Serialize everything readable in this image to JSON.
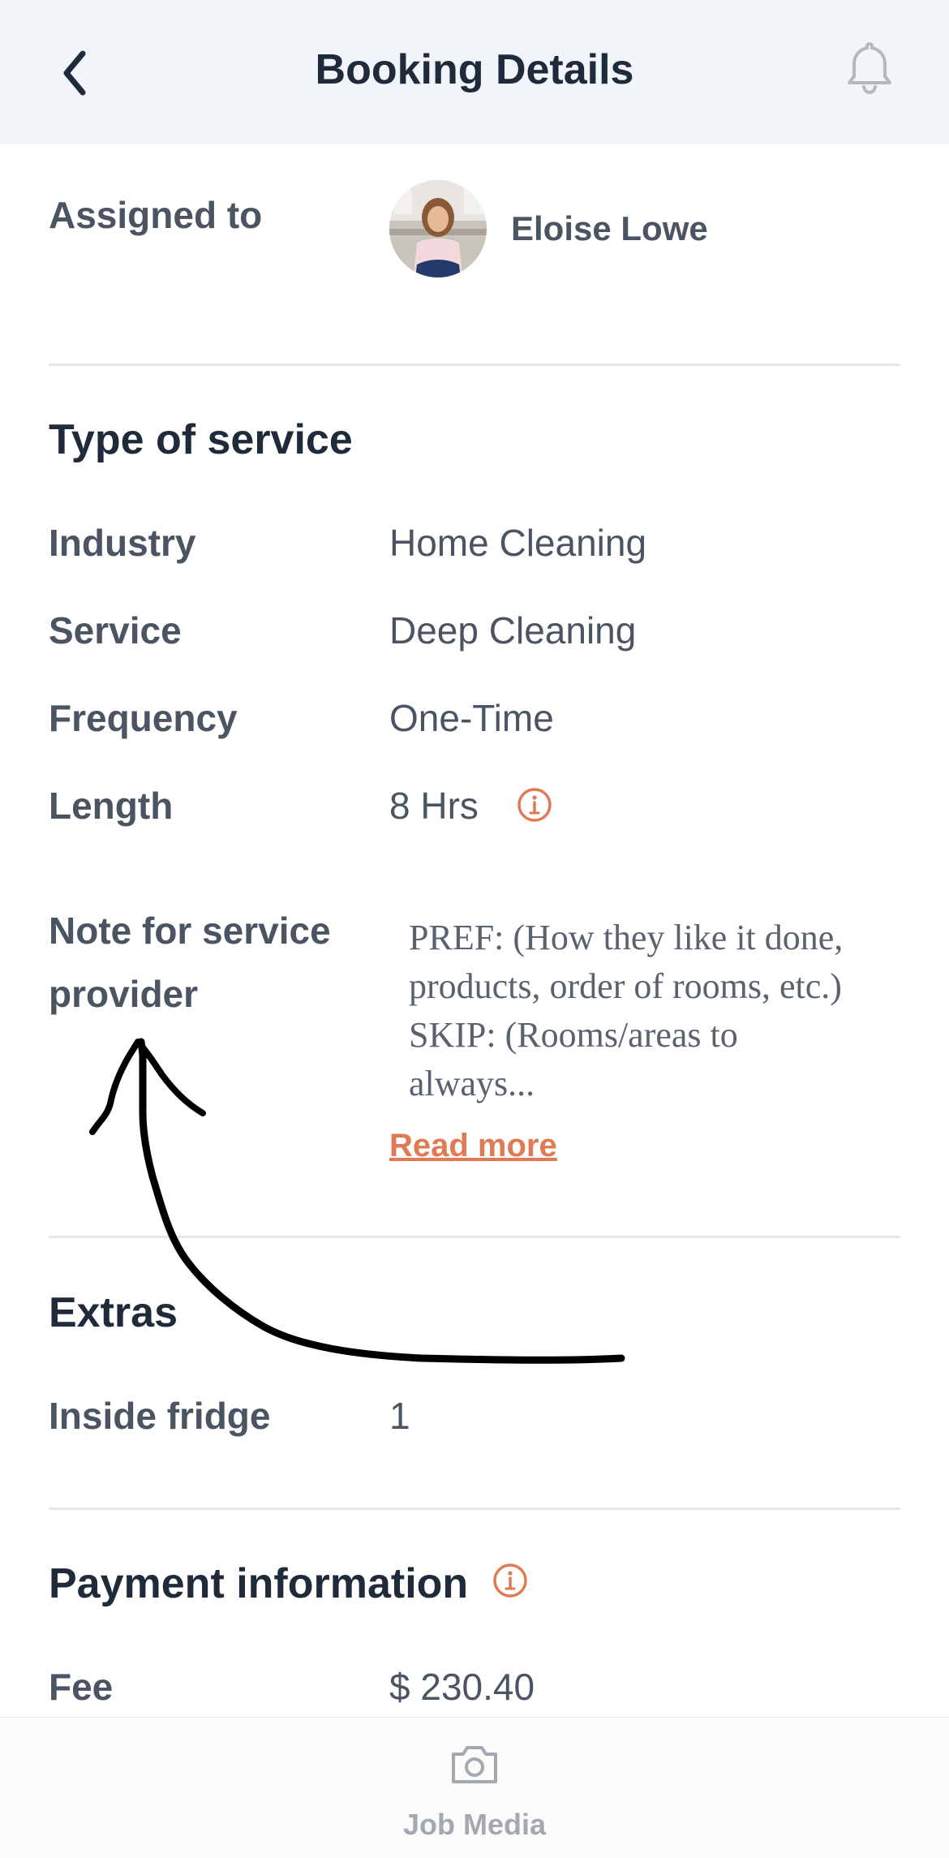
{
  "header": {
    "title": "Booking Details",
    "back_icon": "chevron-left-icon",
    "notification_icon": "bell-icon"
  },
  "assignment": {
    "label": "Assigned to",
    "name": "Eloise Lowe"
  },
  "type_of_service": {
    "title": "Type of service",
    "rows": [
      {
        "label": "Industry",
        "value": "Home Cleaning"
      },
      {
        "label": "Service",
        "value": "Deep Cleaning"
      },
      {
        "label": "Frequency",
        "value": "One-Time"
      },
      {
        "label": "Length",
        "value": "8 Hrs"
      }
    ]
  },
  "note": {
    "label_line1": "Note for service",
    "label_line2": "provider",
    "text": "PREF: (How they like it done, products, order of rooms, etc.) SKIP: (Rooms/areas to always...",
    "read_more": "Read more"
  },
  "extras": {
    "title": "Extras",
    "rows": [
      {
        "label": "Inside fridge",
        "value": "1"
      }
    ]
  },
  "payment": {
    "title": "Payment information",
    "rows": [
      {
        "label": "Fee",
        "value": "$ 230.40"
      }
    ]
  },
  "bottom_bar": {
    "job_media_label": "Job Media"
  },
  "colors": {
    "accent": "#e07a52",
    "title_text": "#1f2a3a",
    "body_text": "#4a5462",
    "header_bg": "#f1f4f8"
  }
}
